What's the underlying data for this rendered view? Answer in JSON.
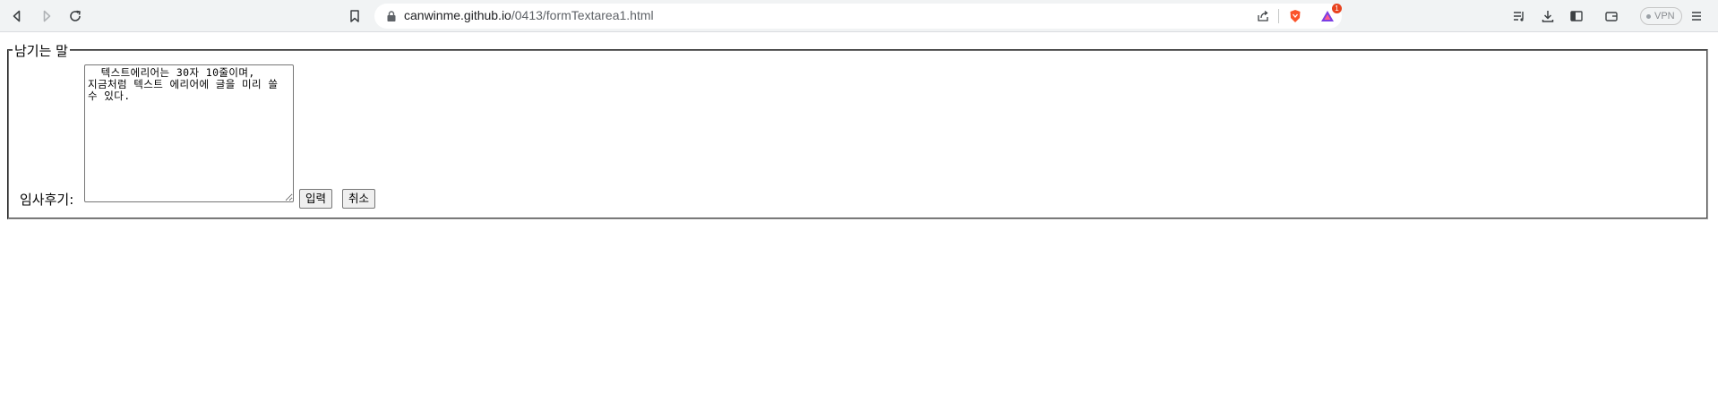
{
  "browser": {
    "url_host": "canwinme.github.io",
    "url_path": "/0413/formTextarea1.html",
    "extension_badge": "1",
    "vpn_label": "VPN",
    "icons": {
      "back": "back-icon",
      "forward": "forward-icon",
      "reload": "reload-icon",
      "bookmark": "bookmark-icon",
      "lock": "lock-icon",
      "share": "share-icon",
      "brave": "brave-shield-icon",
      "rewards": "brave-rewards-icon",
      "playlist": "playlist-icon",
      "download": "download-icon",
      "sidebar": "sidebar-icon",
      "wallet": "wallet-icon",
      "menu": "menu-icon"
    }
  },
  "form": {
    "legend": "남기는 말",
    "label": "임사후기:",
    "textarea_value": "  텍스트에리어는 30자 10줄이며,\n지금처럼 텍스트 에리어에 글을 미리 쓸 수 있다.",
    "submit_label": "입력",
    "reset_label": "취소"
  },
  "colors": {
    "toolbar_bg": "#f1f3f4",
    "brave_orange": "#fb542b",
    "badge_red": "#e8431f"
  }
}
